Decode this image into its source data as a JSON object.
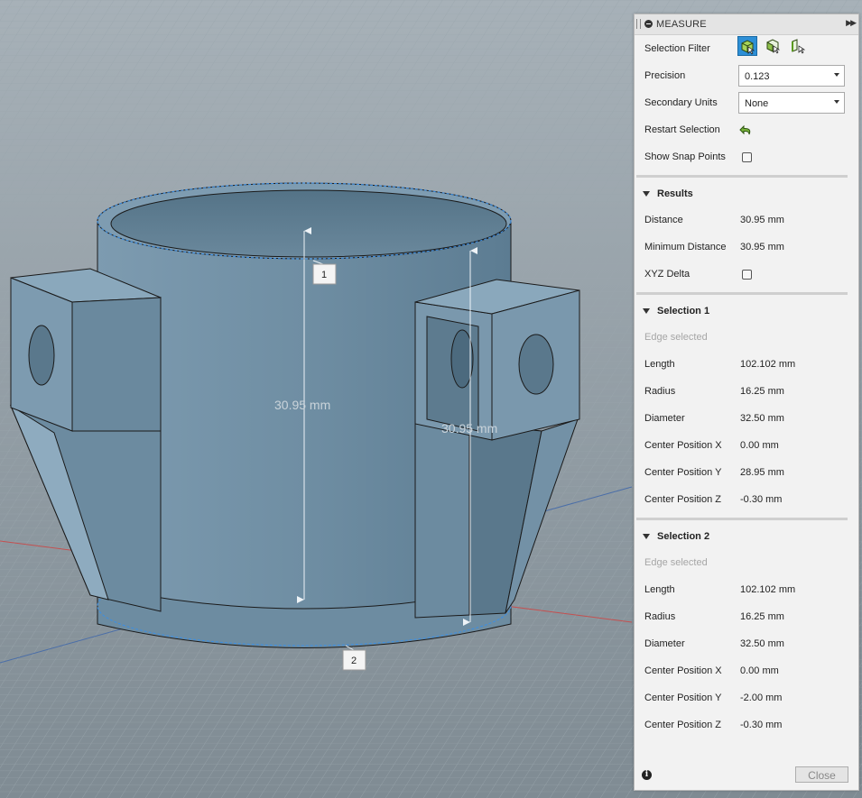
{
  "viewport": {
    "dim_label_1": "30.95 mm",
    "dim_label_2": "30.95 mm",
    "point_labels": [
      "1",
      "2"
    ]
  },
  "panel": {
    "title": "MEASURE",
    "selection_filter_label": "Selection Filter",
    "precision_label": "Precision",
    "precision_value": "0.123",
    "secondary_units_label": "Secondary Units",
    "secondary_units_value": "None",
    "restart_selection_label": "Restart Selection",
    "show_snap_points_label": "Show Snap Points",
    "show_snap_points_checked": false
  },
  "results": {
    "title": "Results",
    "distance_label": "Distance",
    "distance_value": "30.95 mm",
    "min_distance_label": "Minimum Distance",
    "min_distance_value": "30.95 mm",
    "xyz_delta_label": "XYZ Delta",
    "xyz_delta_checked": false
  },
  "selection1": {
    "title": "Selection 1",
    "status": "Edge selected",
    "rows": [
      {
        "label": "Length",
        "value": "102.102 mm"
      },
      {
        "label": "Radius",
        "value": "16.25 mm"
      },
      {
        "label": "Diameter",
        "value": "32.50 mm"
      },
      {
        "label": "Center Position X",
        "value": "0.00 mm"
      },
      {
        "label": "Center Position Y",
        "value": "28.95 mm"
      },
      {
        "label": "Center Position Z",
        "value": "-0.30 mm"
      }
    ]
  },
  "selection2": {
    "title": "Selection 2",
    "status": "Edge selected",
    "rows": [
      {
        "label": "Length",
        "value": "102.102 mm"
      },
      {
        "label": "Radius",
        "value": "16.25 mm"
      },
      {
        "label": "Diameter",
        "value": "32.50 mm"
      },
      {
        "label": "Center Position X",
        "value": "0.00 mm"
      },
      {
        "label": "Center Position Y",
        "value": "-2.00 mm"
      },
      {
        "label": "Center Position Z",
        "value": "-0.30 mm"
      }
    ]
  },
  "footer": {
    "close_label": "Close",
    "info_glyph": "i"
  },
  "colors": {
    "accent": "#2d8fd6",
    "model_body": "#7a98ad",
    "grid_background": "#8e9aa2",
    "edge_highlight": "#3a8fe6"
  }
}
